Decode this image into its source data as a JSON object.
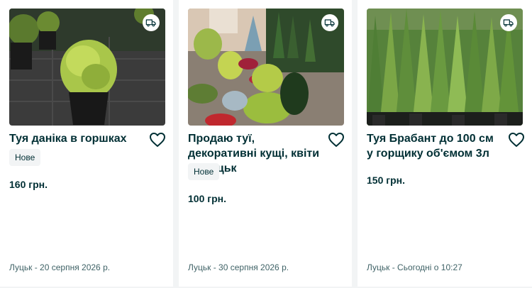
{
  "listings": [
    {
      "title": "Туя даніка в горшках",
      "condition": "Нове",
      "price": "160 грн.",
      "location_date": "Луцьк - 20 серпня 2026 р.",
      "image_icon": "delivery-truck-icon"
    },
    {
      "title": "Продаю туї, декоративні кущі, квіти м. Луцьк",
      "condition": "Нове",
      "price": "100 грн.",
      "location_date": "Луцьк - 30 серпня 2026 р.",
      "image_icon": "delivery-truck-icon"
    },
    {
      "title": "Туя Брабант до 100 см у горщику об'ємом 3л",
      "condition": "",
      "price": "150 грн.",
      "location_date": "Луцьк - Сьогодні о 10:27",
      "image_icon": "delivery-truck-icon"
    }
  ],
  "colors": {
    "text_primary": "#002f34",
    "text_secondary": "#406367",
    "badge_bg": "#f2f4f5",
    "page_bg": "#f2f4f5"
  }
}
